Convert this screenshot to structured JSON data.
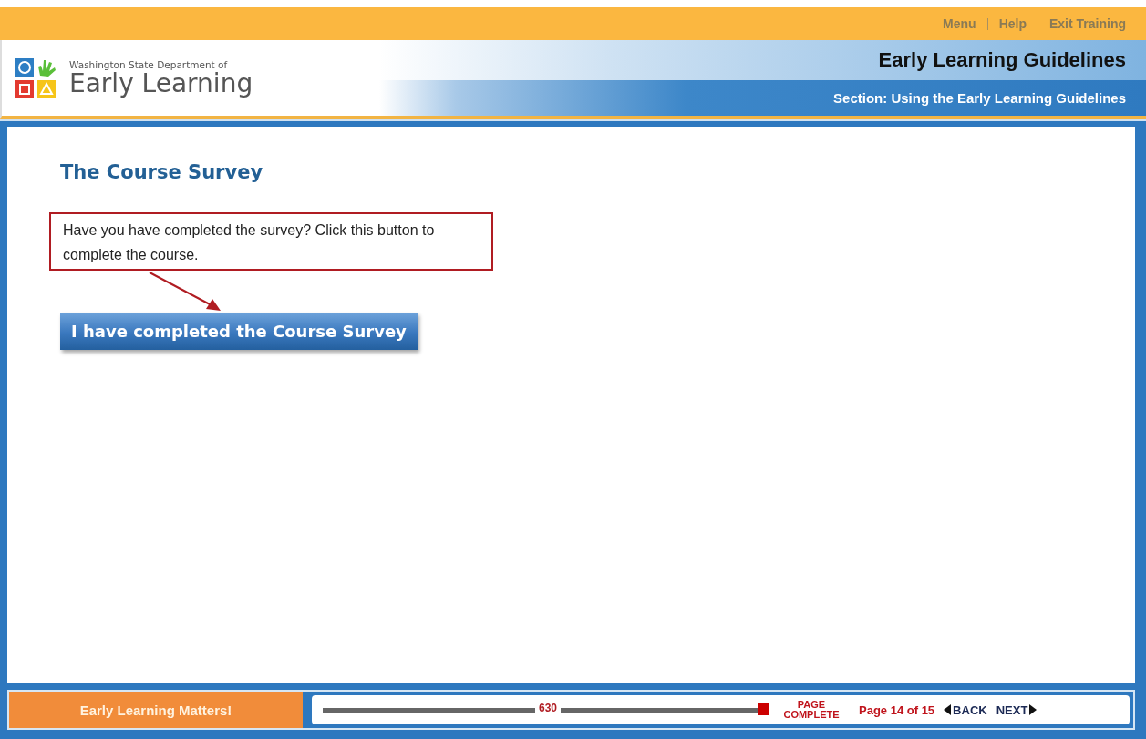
{
  "top_links": [
    "Menu",
    "Help",
    "Exit Training"
  ],
  "logo": {
    "subtitle": "Washington State Department of",
    "title": "Early Learning"
  },
  "course_title": "Early Learning Guidelines",
  "section": "Section: Using the Early Learning Guidelines",
  "page_title": "The Course Survey",
  "callout": "Have you have completed the survey? Click this button to complete the course.",
  "action_button": "I have completed the Course Survey",
  "footer": {
    "tagline": "Early Learning Matters!",
    "progress": {
      "label": "630",
      "level": 1
    },
    "status": "PAGE COMPLETE",
    "page": "Page 14 of 15",
    "back": "BACK",
    "next": "NEXT"
  }
}
